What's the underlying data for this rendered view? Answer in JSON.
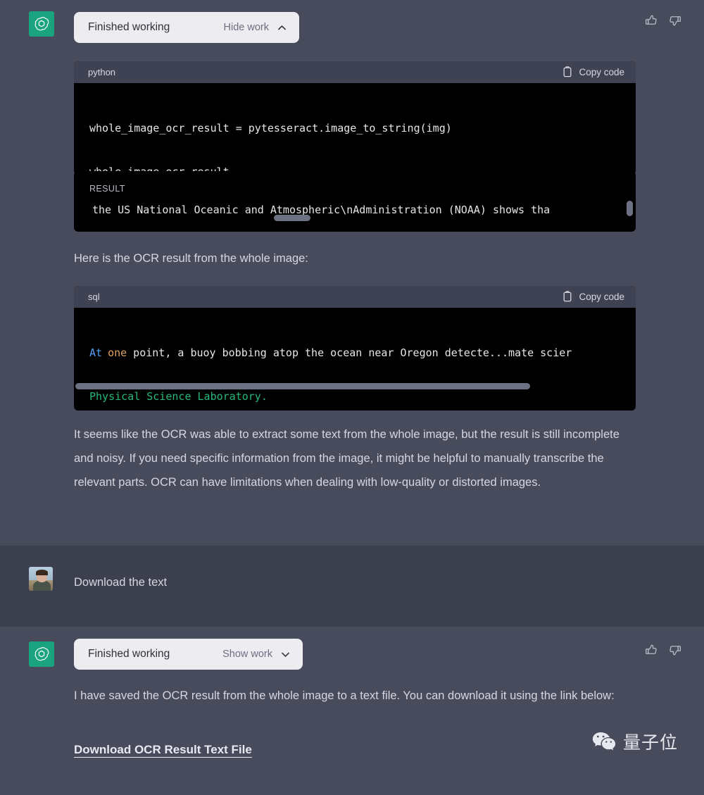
{
  "turns": [
    {
      "role": "assistant",
      "avatar_icon": "openai-logo-icon",
      "work_pill": {
        "title": "Finished working",
        "toggle": "Hide work",
        "chevron": "chevron-up-icon"
      },
      "code_blocks": [
        {
          "lang": "python",
          "copy_label": "Copy code",
          "copy_icon": "clipboard-icon",
          "lines": [
            "whole_image_ocr_result = pytesseract.image_to_string(img)",
            "whole_image_ocr_result"
          ]
        }
      ],
      "result_block": {
        "label": "RESULT",
        "text": "the US National Oceanic and Atmospheric\\nAdministration (NOAA) shows tha",
        "has_horizontal_scrollbar": true,
        "has_vertical_scrollbar": true
      },
      "paragraph_1": "Here is the OCR result from the whole image:",
      "sql_block": {
        "lang": "sql",
        "copy_label": "Copy code",
        "copy_icon": "clipboard-icon",
        "line1_kw": "At",
        "line1_num": "one",
        "line1_rest": " point, a buoy bobbing atop the ocean near Oregon detecte...mate scier",
        "line2_str": "Physical Science Laboratory.",
        "has_horizontal_scrollbar": true
      },
      "paragraph_2": "It seems like the OCR was able to extract some text from the whole image, but the result is still incomplete and noisy. If you need specific information from the image, it might be helpful to manually transcribe the relevant parts. OCR can have limitations when dealing with low-quality or distorted images.",
      "feedback": {
        "thumbs_up": "thumbs-up-icon",
        "thumbs_down": "thumbs-down-icon"
      }
    },
    {
      "role": "user",
      "avatar_icon": "user-photo-avatar",
      "message": "Download the text"
    },
    {
      "role": "assistant",
      "avatar_icon": "openai-logo-icon",
      "work_pill": {
        "title": "Finished working",
        "toggle": "Show work",
        "chevron": "chevron-down-icon"
      },
      "paragraph_1": "I have saved the OCR result from the whole image to a text file. You can download it using the link below:",
      "download_link": "Download OCR Result Text File",
      "feedback": {
        "thumbs_up": "thumbs-up-icon",
        "thumbs_down": "thumbs-down-icon"
      }
    }
  ],
  "watermark": {
    "icon": "wechat-icon",
    "text": "量子位"
  },
  "colors": {
    "assistant_bg": "#474B5B",
    "user_bg": "#3C3F4E",
    "code_bg": "#000000",
    "code_head_bg": "#3F4252",
    "pill_bg": "#ECECF1",
    "accent_green": "#19A37F",
    "token_keyword": "#4EA1F3",
    "token_number": "#E2A25F",
    "token_string": "#29B77A"
  }
}
